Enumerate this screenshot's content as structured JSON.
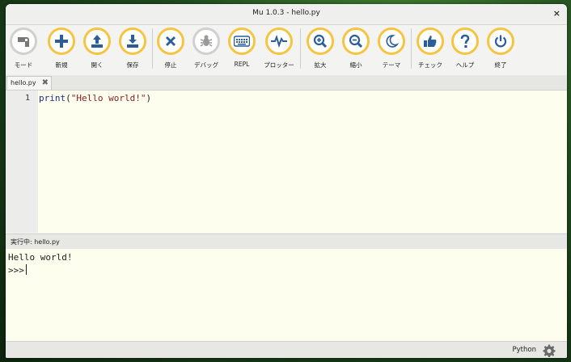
{
  "window": {
    "title": "Mu 1.0.3 - hello.py",
    "close_label": "×"
  },
  "toolbar": {
    "buttons": [
      {
        "label": "モード",
        "icon": "mode-icon"
      },
      {
        "label": "新規",
        "icon": "plus-icon"
      },
      {
        "label": "開く",
        "icon": "upload-icon"
      },
      {
        "label": "保存",
        "icon": "download-icon"
      },
      {
        "label": "停止",
        "icon": "close-icon"
      },
      {
        "label": "デバッグ",
        "icon": "bug-icon"
      },
      {
        "label": "REPL",
        "icon": "keyboard-icon"
      },
      {
        "label": "プロッター",
        "icon": "pulse-icon"
      },
      {
        "label": "拡大",
        "icon": "zoom-in-icon"
      },
      {
        "label": "縮小",
        "icon": "zoom-out-icon"
      },
      {
        "label": "テーマ",
        "icon": "moon-icon"
      },
      {
        "label": "チェック",
        "icon": "thumbs-up-icon"
      },
      {
        "label": "ヘルプ",
        "icon": "question-icon"
      },
      {
        "label": "終了",
        "icon": "power-icon"
      }
    ]
  },
  "tabs": [
    {
      "label": "hello.py",
      "close_label": "✖"
    }
  ],
  "editor": {
    "line_number": "1",
    "code_keyword": "print",
    "code_open": "(",
    "code_string": "\"Hello world!\"",
    "code_close": ")"
  },
  "runner": {
    "status": "実行中: hello.py"
  },
  "repl": {
    "output": "Hello world!",
    "prompt": ">>>"
  },
  "footer": {
    "mode": "Python"
  },
  "colors": {
    "accent": "#f5c542",
    "icon": "#2b5d9a",
    "editor_bg": "#fefeee"
  }
}
